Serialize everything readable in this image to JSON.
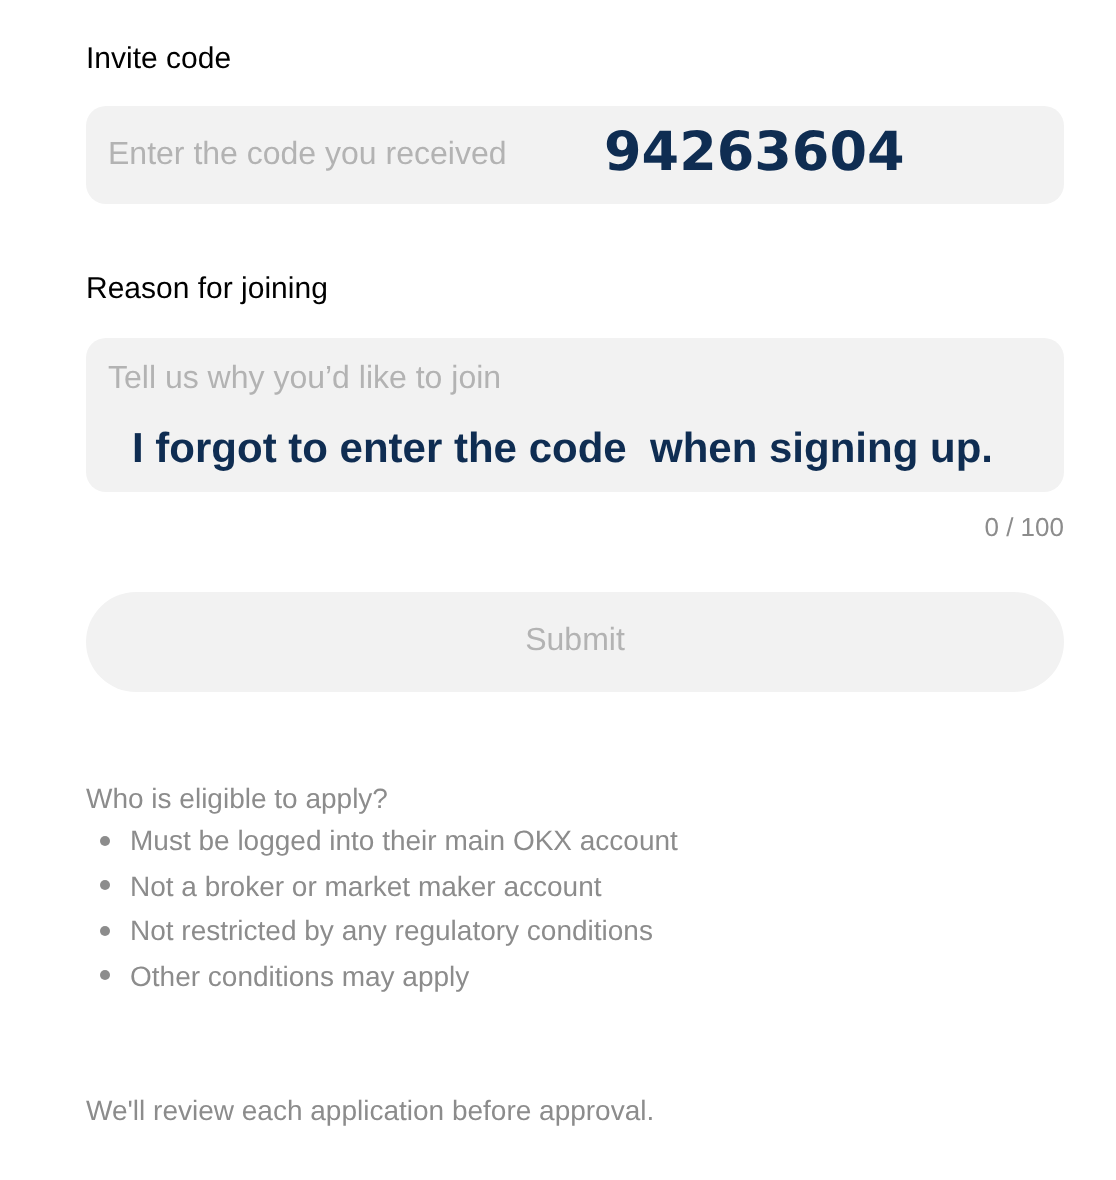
{
  "invite_code": {
    "label": "Invite code",
    "placeholder": "Enter the code you received",
    "annotation": "94263604"
  },
  "reason": {
    "label": "Reason for joining",
    "placeholder": "Tell us why you’d like to join",
    "annotation": "I forgot to enter the code  when signing up.",
    "counter": "0 / 100"
  },
  "submit": {
    "label": "Submit",
    "disabled": true
  },
  "eligibility": {
    "title": "Who is eligible to apply?",
    "items": [
      "Must be logged into their main OKX account",
      "Not a broker or market maker account",
      "Not restricted by any regulatory conditions",
      "Other conditions may apply"
    ]
  },
  "note": "We'll review each application before approval."
}
